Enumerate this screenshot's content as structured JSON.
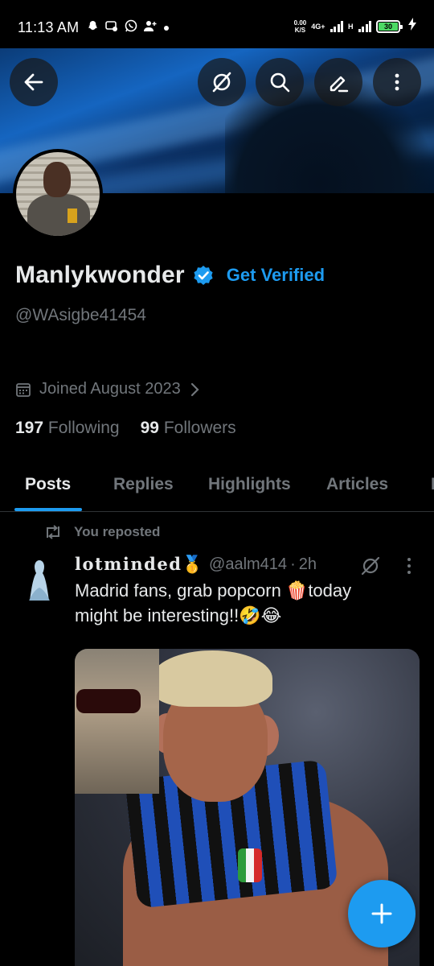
{
  "status_bar": {
    "time": "11:13 AM",
    "notification_icons": [
      "snapchat-icon",
      "message-icon",
      "whatsapp-icon",
      "add-person-icon",
      "dot-icon"
    ],
    "net_speed": "0.00",
    "net_unit": "K/S",
    "network_1": "4G+",
    "network_2": "H",
    "battery": "30",
    "charging": true
  },
  "toolbar": {
    "back_icon": "back-arrow-icon",
    "grok_icon": "grok-icon",
    "search_icon": "search-icon",
    "edit_icon": "edit-icon",
    "more_icon": "more-vertical-icon"
  },
  "profile": {
    "name": "Manlykwonder",
    "verified_badge": "verified-badge-icon",
    "get_verified": "Get Verified",
    "handle": "@WAsigbe41454",
    "joined": "Joined August 2023",
    "following_count": "197",
    "following_label": "Following",
    "followers_count": "99",
    "followers_label": "Followers"
  },
  "tabs": [
    {
      "label": "Posts",
      "active": true
    },
    {
      "label": "Replies",
      "active": false
    },
    {
      "label": "Highlights",
      "active": false
    },
    {
      "label": "Articles",
      "active": false
    },
    {
      "label": "M",
      "active": false
    }
  ],
  "post": {
    "repost_label": "You reposted",
    "author_name": "lotminded🥇",
    "author_handle": "@aalm414",
    "separator": "·",
    "time": "2h",
    "text_line1": "Madrid fans, grab popcorn 🍿today",
    "text_line2": "might be interesting!!🤣😂"
  },
  "colors": {
    "accent": "#1d9bf0",
    "background": "#000000",
    "text_primary": "#e7e9ea",
    "text_secondary": "#71767b",
    "divider": "#2f3336"
  },
  "fab": {
    "icon": "plus-icon"
  }
}
